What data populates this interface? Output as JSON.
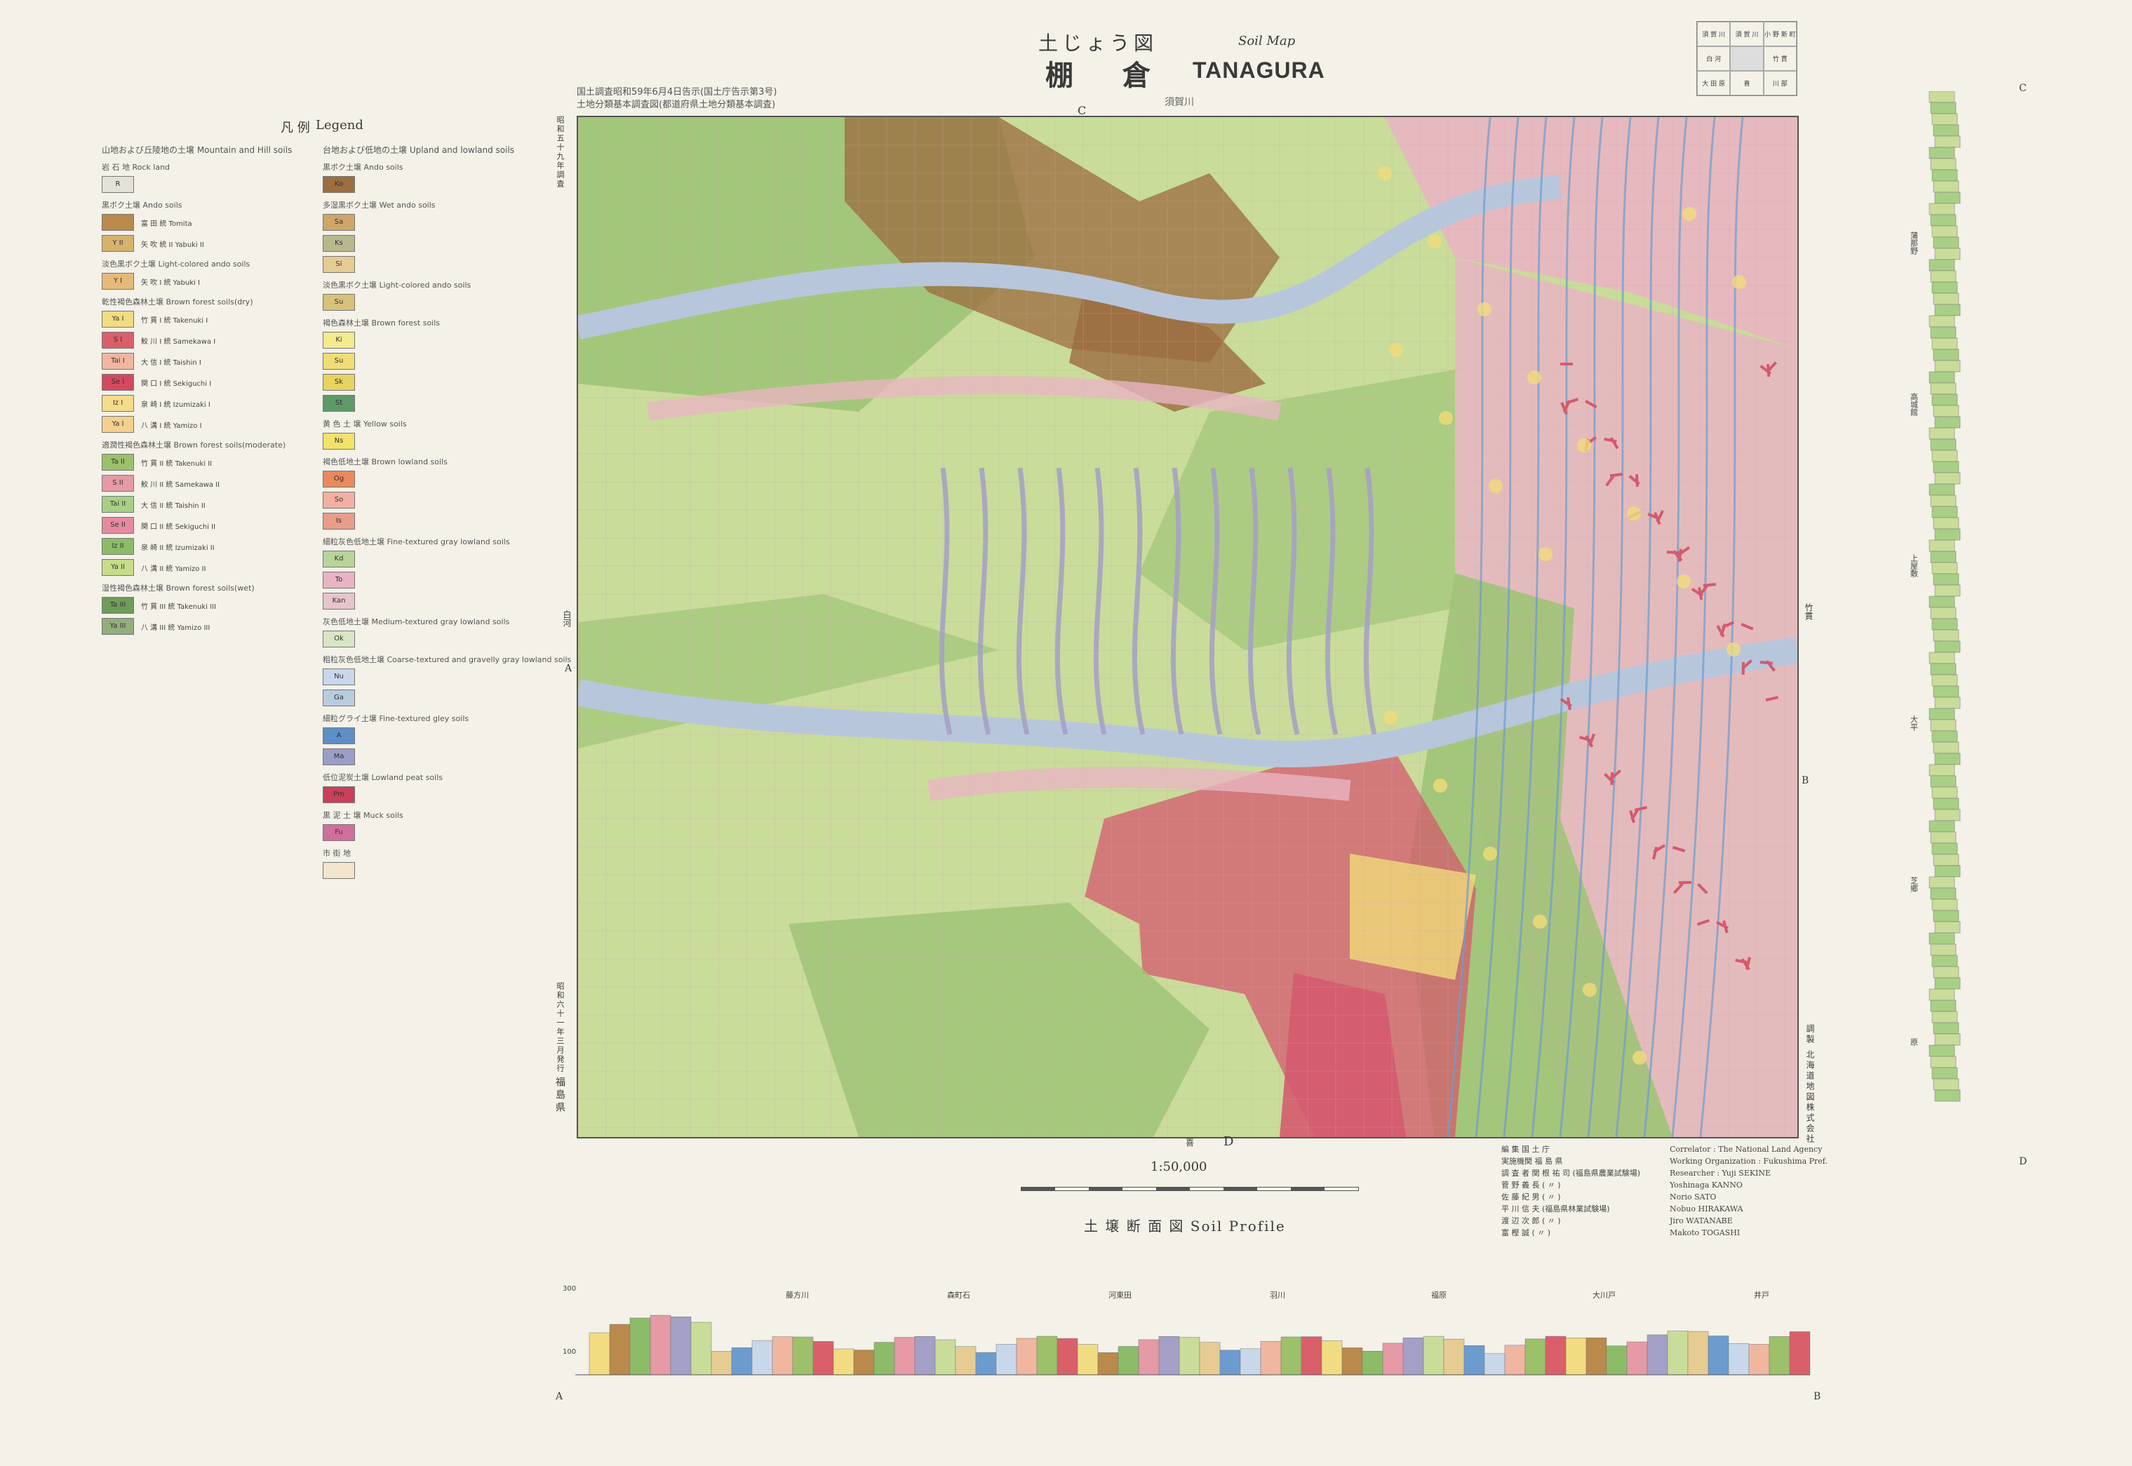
{
  "title": {
    "heading_ja": "土じょう図",
    "heading_en": "Soil Map",
    "name_ja": "棚 倉",
    "name_en": "TANAGURA"
  },
  "survey_note": {
    "line1": "国土調査昭和59年6月4日告示(国土庁告示第3号)",
    "line2": "土地分類基本調査図(都道府県土地分類基本調査)"
  },
  "legend": {
    "heading_ja": "凡 例",
    "heading_en": "Legend",
    "mountain": {
      "heading": "山地および丘陵地の土壌 Mountain and Hill soils",
      "groups": [
        {
          "label": "岩 石 地 Rock land",
          "items": [
            {
              "code": "R",
              "name": "",
              "color": "#e4e2d8"
            }
          ]
        },
        {
          "label": "黒ボク土壌 Ando soils",
          "items": [
            {
              "code": "",
              "name": "富 田 統 Tomita",
              "color": "#b98a4b"
            },
            {
              "code": "Y II",
              "name": "矢 吹 統 II Yabuki II",
              "color": "#d6b36c"
            }
          ]
        },
        {
          "label": "淡色黒ボク土壌 Light-colored ando soils",
          "items": [
            {
              "code": "Y I",
              "name": "矢 吹 I 統 Yabuki I",
              "color": "#e6b87a"
            }
          ]
        },
        {
          "label": "乾性褐色森林土壌 Brown forest soils(dry)",
          "items": [
            {
              "code": "Ya I",
              "name": "竹 貫 I 統 Takenuki I",
              "color": "#f2dc82"
            },
            {
              "code": "S I",
              "name": "鮫 川 I 統 Samekawa I",
              "color": "#d9606a"
            },
            {
              "code": "Tai I",
              "name": "大 信 I 統 Taishin I",
              "color": "#f0b6a0"
            },
            {
              "code": "Se I",
              "name": "関 口 I 統 Sekiguchi I",
              "color": "#d24a5e"
            },
            {
              "code": "Iz I",
              "name": "泉 崎 I 統 Izumizaki I",
              "color": "#f5dc8a"
            },
            {
              "code": "Ya I",
              "name": "八 溝 I 統 Yamizo I",
              "color": "#f3d18c"
            }
          ]
        },
        {
          "label": "適潤性褐色森林土壌 Brown forest soils(moderate)",
          "items": [
            {
              "code": "Ta II",
              "name": "竹 貫 II 統 Takenuki II",
              "color": "#9dc06a"
            },
            {
              "code": "S II",
              "name": "鮫 川 II 統 Samekawa II",
              "color": "#e59aa6"
            },
            {
              "code": "Tai II",
              "name": "大 信 II 統 Taishin II",
              "color": "#a9cf86"
            },
            {
              "code": "Se II",
              "name": "関 口 II 統 Sekiguchi II",
              "color": "#e58aa0"
            },
            {
              "code": "Iz II",
              "name": "泉 崎 II 統 Izumizaki II",
              "color": "#8cbc68"
            },
            {
              "code": "Ya II",
              "name": "八 溝 II 統 Yamizo II",
              "color": "#c6dc8a"
            }
          ]
        },
        {
          "label": "湿性褐色森林土壌 Brown forest soils(wet)",
          "items": [
            {
              "code": "Ta III",
              "name": "竹 貫 III 統 Takenuki III",
              "color": "#6f9c5a"
            },
            {
              "code": "Ya III",
              "name": "八 溝 III 統 Yamizo III",
              "color": "#93ad7c"
            }
          ]
        }
      ]
    },
    "upland": {
      "heading": "台地および低地の土壌 Upland and lowland soils",
      "groups": [
        {
          "label": "黒ボク土壌 Ando soils",
          "items": [
            {
              "code": "Ko",
              "name": "",
              "color": "#9c6e40"
            }
          ]
        },
        {
          "label": "多湿黒ボク土壌 Wet ando soils",
          "items": [
            {
              "code": "Sa",
              "name": "",
              "color": "#cfa56a"
            },
            {
              "code": "Ks",
              "name": "",
              "color": "#b9b88c"
            },
            {
              "code": "Si",
              "name": "",
              "color": "#e6cc92"
            }
          ]
        },
        {
          "label": "淡色黒ボク土壌 Light-colored ando soils",
          "items": [
            {
              "code": "Su",
              "name": "",
              "color": "#d8c27a"
            }
          ]
        },
        {
          "label": "褐色森林土壌 Brown forest soils",
          "items": [
            {
              "code": "Ki",
              "name": "",
              "color": "#f4ea8e"
            },
            {
              "code": "Su",
              "name": "",
              "color": "#f0de74"
            },
            {
              "code": "Sk",
              "name": "",
              "color": "#e8d260"
            },
            {
              "code": "St",
              "name": "",
              "color": "#5e9a68"
            }
          ]
        },
        {
          "label": "黄 色 土 壌 Yellow soils",
          "items": [
            {
              "code": "Ns",
              "name": "",
              "color": "#f3e26a"
            }
          ]
        },
        {
          "label": "褐色低地土壌 Brown lowland soils",
          "items": [
            {
              "code": "Og",
              "name": "",
              "color": "#e88a5c"
            },
            {
              "code": "So",
              "name": "",
              "color": "#f2b0a2"
            },
            {
              "code": "Is",
              "name": "",
              "color": "#e89c8a"
            }
          ]
        },
        {
          "label": "細粒灰色低地土壌 Fine-textured gray lowland soils",
          "items": [
            {
              "code": "Kd",
              "name": "",
              "color": "#b9d49a"
            },
            {
              "code": "To",
              "name": "",
              "color": "#e8b4c4"
            },
            {
              "code": "Kan",
              "name": "",
              "color": "#e8c4cc"
            }
          ]
        },
        {
          "label": "灰色低地土壌 Medium-textured gray lowland soils",
          "items": [
            {
              "code": "Ok",
              "name": "",
              "color": "#d9e6c6"
            }
          ]
        },
        {
          "label": "粗粒灰色低地土壌 Coarse-textured and gravelly gray lowland soils",
          "items": [
            {
              "code": "Nu",
              "name": "",
              "color": "#c8d8ea"
            },
            {
              "code": "Ga",
              "name": "",
              "color": "#b8cce0"
            }
          ]
        },
        {
          "label": "細粒グライ土壌 Fine-textured gley soils",
          "items": [
            {
              "code": "A",
              "name": "",
              "color": "#5e8ec6"
            },
            {
              "code": "Ma",
              "name": "",
              "color": "#9a9ec8"
            }
          ]
        },
        {
          "label": "低位泥炭土壌 Lowland peat soils",
          "items": [
            {
              "code": "Pm",
              "name": "",
              "color": "#c8405a"
            }
          ]
        },
        {
          "label": "黒 泥 土 壌 Muck soils",
          "items": [
            {
              "code": "Fu",
              "name": "",
              "color": "#d0709a"
            }
          ]
        },
        {
          "label": "市 街 地",
          "items": [
            {
              "code": "",
              "name": "",
              "color": "#f3e4cc"
            }
          ]
        }
      ]
    }
  },
  "map": {
    "top_place": "須賀川",
    "left_place": "白河",
    "right_place": "竹貫",
    "bottom_place": "喜",
    "marker_c": "C",
    "marker_d": "D",
    "marker_a": "A",
    "marker_b": "B",
    "left_side_text": "昭和五十九年調査",
    "left_side_text2": "昭和六十一年三月発行",
    "left_side_pref": "福島県",
    "right_side_text": "調製 北海道地図株式会社",
    "colors": {
      "green": "#9fc477",
      "light_green": "#c9dc9a",
      "pink": "#e9b5c2",
      "red": "#d45a6e",
      "brown": "#9b6b3f",
      "blue": "#6c9ccf",
      "gray_blue": "#b8c6dc",
      "yellow": "#f0dc7a",
      "lavender": "#a49fc6"
    }
  },
  "scale": "1:50,000",
  "profile": {
    "title": "土 壌 断 面 図  Soil Profile",
    "start_label": "A",
    "end_label": "B",
    "place_labels": [
      "藤方川",
      "森町石",
      "河東田",
      "羽川",
      "福原",
      "大川戸",
      "井戸"
    ],
    "axis_ticks": [
      "300",
      "100"
    ]
  },
  "right_column": {
    "top_label": "C",
    "bottom_label": "D",
    "place_labels": [
      "蒲那野",
      "高城館",
      "上屋敷",
      "大平",
      "芝郷",
      "原"
    ]
  },
  "credits": {
    "ja": [
      "編 集  国 土 庁",
      "実施機関  福 島 県",
      "調 査 者  関 根 祐 司 (福島県農業試験場)",
      "菅 野 義 長 (  〃  )",
      "佐 藤 紀 男 (  〃  )",
      "平 川 信 夫 (福島県林業試験場)",
      "渡 辺 次 郎 (  〃  )",
      "富 樫 誠 (  〃  )"
    ],
    "en": [
      "Correlator : The National Land Agency",
      "Working Organization : Fukushima Pref.",
      "Researcher : Yuji SEKINE",
      "Yoshinaga KANNO",
      "Norio SATO",
      "Nobuo HIRAKAWA",
      "Jiro WATANABE",
      "Makoto TOGASHI"
    ]
  },
  "index_box": {
    "cells": [
      "須 賀 川",
      "須 賀 川",
      "小 野 新 町",
      "白 河",
      "",
      "竹 貫",
      "大 田 原",
      "喜",
      "川 部"
    ]
  }
}
